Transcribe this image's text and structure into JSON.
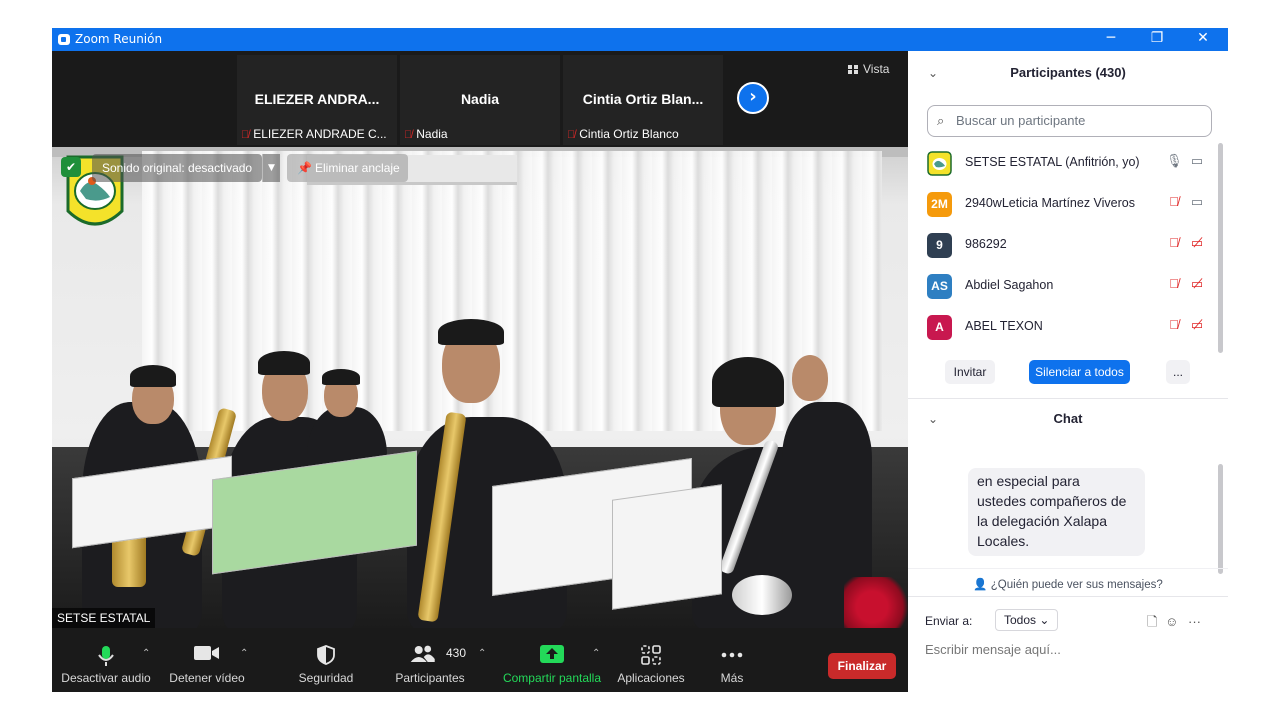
{
  "window": {
    "title": "Zoom Reunión",
    "minimize": "─",
    "restore": "❐",
    "close": "✕",
    "accent": "#0e72ed"
  },
  "gallery": {
    "tiles": [
      {
        "name": "ELIEZER ANDRA...",
        "label": "ELIEZER ANDRADE C..."
      },
      {
        "name": "Nadia",
        "label": "Nadia"
      },
      {
        "name": "Cintia  Ortiz  Blan...",
        "label": "Cintia Ortiz Blanco"
      }
    ],
    "next_icon": "›",
    "view_label": "Vista"
  },
  "video": {
    "sound_label": "Sonido original: desactivado",
    "unpin_label": "Eliminar anclaje",
    "speaker_name": "SETSE ESTATAL"
  },
  "toolbar": {
    "mute": "Desactivar audio",
    "stop_video": "Detener vídeo",
    "security": "Seguridad",
    "participants": "Participantes",
    "participants_count": "430",
    "share": "Compartir pantalla",
    "apps": "Aplicaciones",
    "more": "Más",
    "end": "Finalizar"
  },
  "participants_panel": {
    "title": "Participantes (430)",
    "search_placeholder": "Buscar un participante",
    "items": [
      {
        "avatar": "",
        "name": "SETSE ESTATAL (Anfitrión, yo)",
        "color": "#ffffff",
        "mic_muted": false,
        "cam_off": false
      },
      {
        "avatar": "2M",
        "name": "2940wLeticia Martínez Viveros",
        "color": "#f59a0c",
        "mic_muted": true,
        "cam_off": false
      },
      {
        "avatar": "9",
        "name": "986292",
        "color": "#2f3f52",
        "mic_muted": true,
        "cam_off": true
      },
      {
        "avatar": "AS",
        "name": "Abdiel Sagahon",
        "color": "#2e7fc2",
        "mic_muted": true,
        "cam_off": true
      },
      {
        "avatar": "A",
        "name": "ABEL TEXON",
        "color": "#c8184f",
        "mic_muted": true,
        "cam_off": true
      }
    ],
    "invite": "Invitar",
    "mute_all": "Silenciar a todos",
    "more": "..."
  },
  "chat_panel": {
    "title": "Chat",
    "message_lines": [
      "en especial para",
      "ustedes compañeros de",
      "la delegación Xalapa",
      "Locales."
    ],
    "who_can_see": "¿Quién puede ver sus mensajes?",
    "send_to_label": "Enviar a:",
    "send_to_value": "Todos",
    "input_placeholder": "Escribir mensaje aquí..."
  }
}
